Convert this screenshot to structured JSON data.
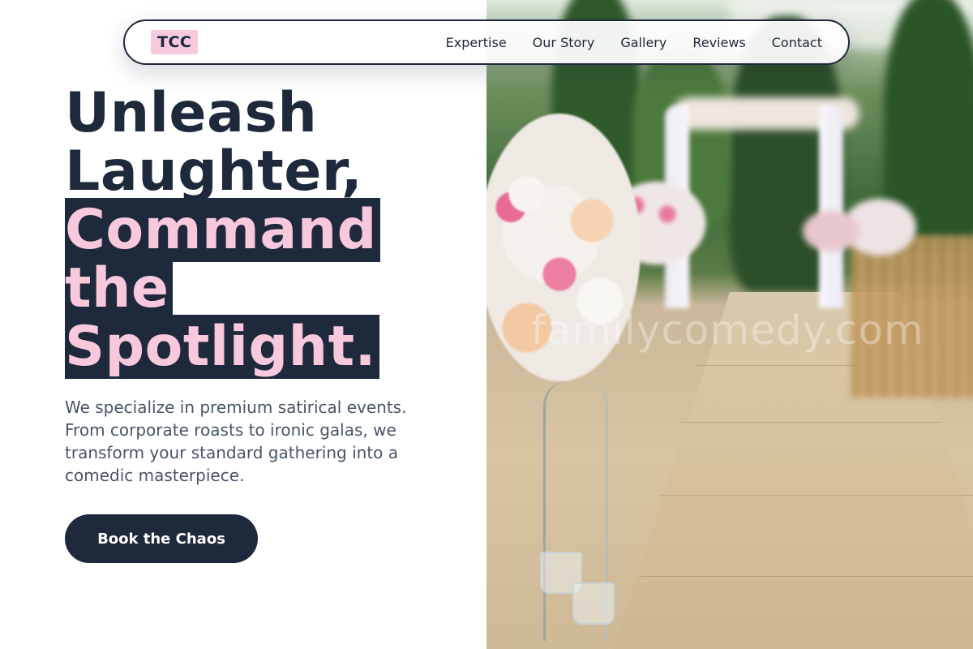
{
  "brand": {
    "logo_text": "TCC"
  },
  "nav": {
    "links": [
      "Expertise",
      "Our Story",
      "Gallery",
      "Reviews",
      "Contact"
    ]
  },
  "hero": {
    "headline_plain": [
      "Unleash",
      "Laughter,"
    ],
    "headline_highlight": " Command the Spotlight.",
    "description": "We specialize in premium satirical events. From corporate roasts to ironic galas, we transform your standard gathering into a comedic masterpiece.",
    "cta_label": "Book the Chaos"
  },
  "photo": {
    "watermark_text": "familycomedy.com"
  },
  "colors": {
    "navy": "#1e293b",
    "pink": "#f8c8dc",
    "body_text": "#475569"
  }
}
